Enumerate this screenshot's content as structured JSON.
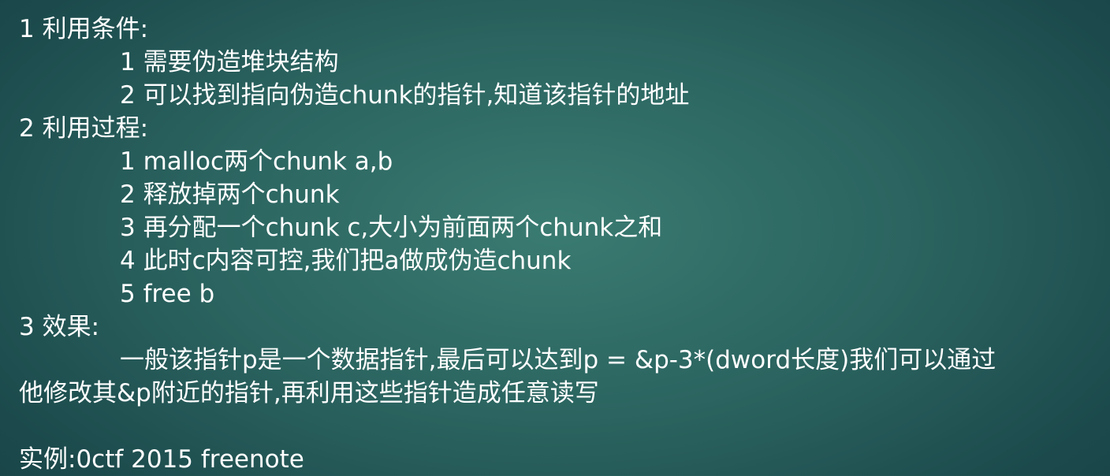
{
  "section1": {
    "heading": "1 利用条件:",
    "items": [
      "1 需要伪造堆块结构",
      "2 可以找到指向伪造chunk的指针,知道该指针的地址"
    ]
  },
  "section2": {
    "heading": "2 利用过程:",
    "items": [
      "1 malloc两个chunk a,b",
      "2 释放掉两个chunk",
      "3 再分配一个chunk c,大小为前面两个chunk之和",
      "4 此时c内容可控,我们把a做成伪造chunk",
      "5 free b"
    ]
  },
  "section3": {
    "heading": "3 效果:",
    "line1": "一般该指针p是一个数据指针,最后可以达到p = &p-3*(dword长度)我们可以通过",
    "line2": "他修改其&p附近的指针,再利用这些指针造成任意读写"
  },
  "example": "实例:0ctf 2015 freenote"
}
